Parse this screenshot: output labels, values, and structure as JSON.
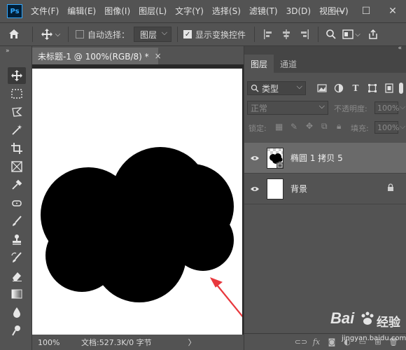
{
  "app": {
    "logo_text": "Ps"
  },
  "menu": [
    "文件(F)",
    "编辑(E)",
    "图像(I)",
    "图层(L)",
    "文字(Y)",
    "选择(S)",
    "滤镜(T)",
    "3D(D)",
    "视图(V)"
  ],
  "window_controls": {
    "minimize": "—",
    "maximize": "☐",
    "close": "✕"
  },
  "options_bar": {
    "auto_select_label": "自动选择：",
    "auto_select_checked": false,
    "auto_select_target": "图层",
    "show_transform_label": "显示变换控件",
    "show_transform_checked": true
  },
  "document": {
    "tab_title": "未标题-1 @ 100%(RGB/8) *",
    "tab_close": "×"
  },
  "status": {
    "zoom": "100%",
    "doc_info": "文档:527.3K/0 字节",
    "arrow": "〉"
  },
  "panel": {
    "tabs": [
      "图层",
      "通道"
    ],
    "filter_kind": "类型",
    "blend_mode": "正常",
    "opacity_label": "不透明度:",
    "opacity_value": "100%",
    "lock_label": "锁定:",
    "fill_label": "填充:",
    "fill_value": "100%"
  },
  "layers": [
    {
      "name": "椭圆 1 拷贝 5",
      "visible": true,
      "selected": true
    },
    {
      "name": "背景",
      "visible": true,
      "selected": false,
      "locked": true
    }
  ],
  "watermark": {
    "brand": "Bai",
    "brand2": "经验",
    "url": "jingyan.baidu.com"
  },
  "colors": {
    "ui_bg": "#535353",
    "canvas_shape": "#000000",
    "annotation_arrow": "#e8383d",
    "ps_blue": "#31a8ff"
  }
}
